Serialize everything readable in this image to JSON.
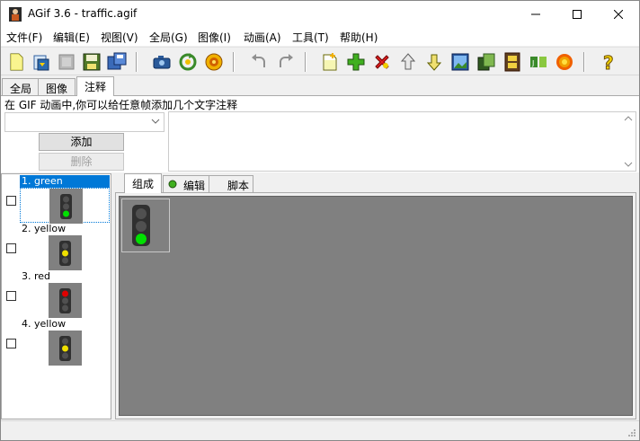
{
  "window": {
    "title": "AGif 3.6 - traffic.agif"
  },
  "menu": [
    "文件(F)",
    "编辑(E)",
    "视图(V)",
    "全局(G)",
    "图像(I)",
    "动画(A)",
    "工具(T)",
    "帮助(H)"
  ],
  "toolbar": {
    "icons": [
      "new-file-icon",
      "open-file-icon",
      "disabled-icon",
      "save-icon",
      "save-as-icon",
      "camera-icon",
      "refresh-icon",
      "gift-icon",
      "undo-icon",
      "redo-icon",
      "new-frame-icon",
      "add-icon",
      "delete-icon",
      "move-up-icon",
      "move-down-icon",
      "image-icon",
      "copy-icon",
      "film-icon",
      "optimize-icon",
      "sun-icon",
      "help-icon"
    ]
  },
  "tabs_top": [
    "全局",
    "图像",
    "注释"
  ],
  "comment": {
    "hint": "在 GIF 动画中,你可以给任意帧添加几个文字注释",
    "combo_value": "",
    "add_label": "添加",
    "delete_label": "删除",
    "text": ""
  },
  "frames": [
    {
      "label": "1. green",
      "light": "green",
      "selected": true
    },
    {
      "label": "2. yellow",
      "light": "yellow",
      "selected": false
    },
    {
      "label": "3. red",
      "light": "red",
      "selected": false
    },
    {
      "label": "4. yellow",
      "light": "yellow",
      "selected": false
    }
  ],
  "tabs_right": [
    "组成",
    "编辑",
    "脚本"
  ],
  "colors": {
    "green": "#00e000",
    "yellow": "#f0e000",
    "red": "#e00000",
    "off": "#505050",
    "canvas": "#808080",
    "selection": "#0078d7"
  }
}
